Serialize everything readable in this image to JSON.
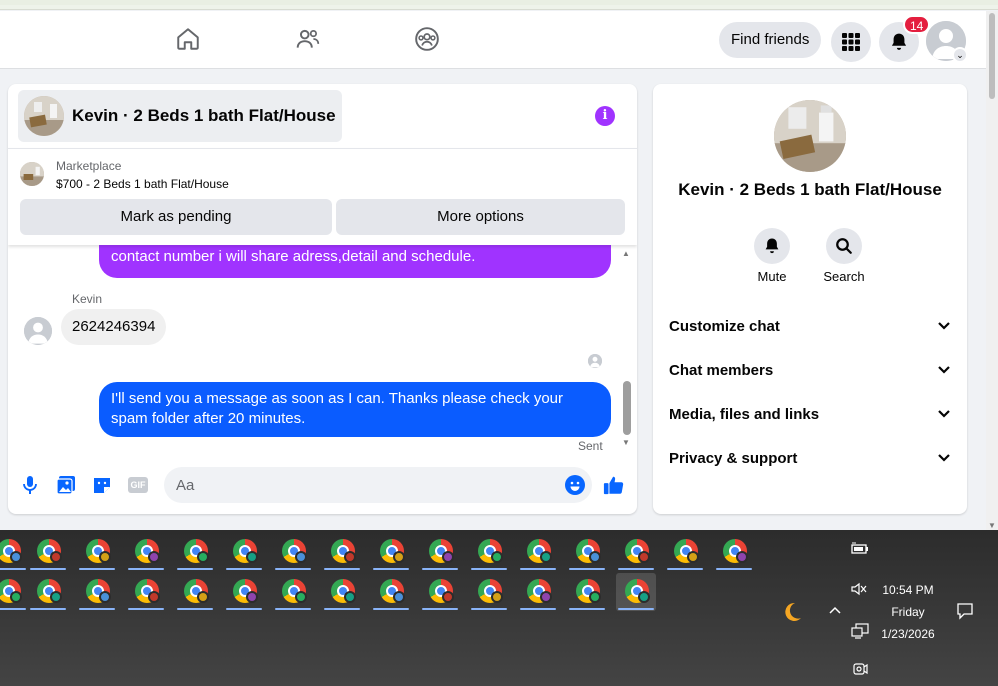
{
  "header": {
    "nav": [
      {
        "name": "home-icon"
      },
      {
        "name": "friends-icon"
      },
      {
        "name": "groups-icon"
      }
    ],
    "find_friends_label": "Find friends",
    "notifications_count": "14",
    "menu_icon": "grid-menu-icon",
    "bell_icon": "bell-icon",
    "profile_caret": "⌄"
  },
  "chat": {
    "title": "Kevin · 2 Beds 1 bath Flat/House",
    "info_glyph": "i",
    "listing": {
      "source": "Marketplace",
      "price_title": "$700 - 2 Beds 1 bath Flat/House",
      "mark_pending_label": "Mark as pending",
      "more_options_label": "More options"
    },
    "messages": {
      "outgoing_partial": "contact number i will share adress,detail and schedule.",
      "sender_name": "Kevin",
      "incoming": "2624246394",
      "outgoing": "I'll send you a message as soon as I can. Thanks please check your spam folder after 20 minutes.",
      "status": "Sent"
    },
    "composer": {
      "placeholder": "Aa",
      "gif_label": "GIF"
    }
  },
  "info_panel": {
    "title": "Kevin · 2 Beds 1 bath Flat/House",
    "mute_label": "Mute",
    "search_label": "Search",
    "sections": [
      {
        "label": "Customize chat"
      },
      {
        "label": "Chat members"
      },
      {
        "label": "Media, files and links"
      },
      {
        "label": "Privacy & support"
      }
    ]
  },
  "taskbar": {
    "time": "10:54 PM",
    "day": "Friday",
    "date": "1/23/2026",
    "profile_colors": [
      "#4a90d9",
      "#c0392b",
      "#d4a017",
      "#8e44ad",
      "#27ae60",
      "#16a085"
    ]
  }
}
